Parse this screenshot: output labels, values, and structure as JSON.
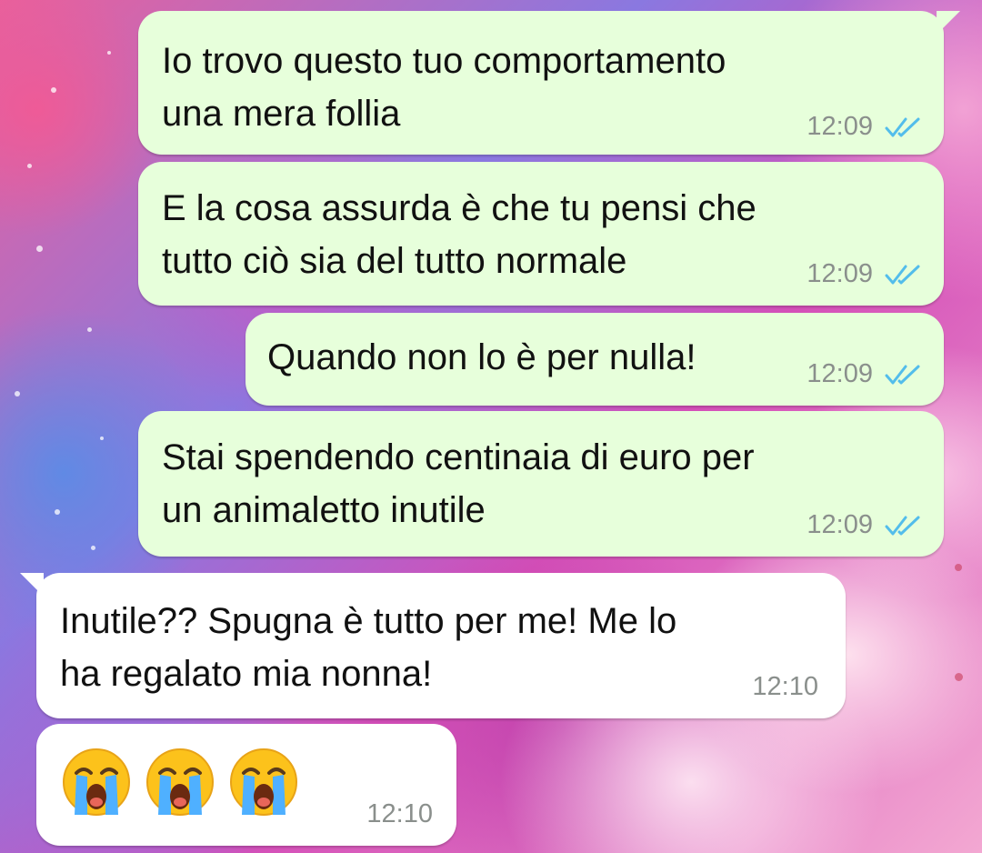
{
  "chat": {
    "messages": [
      {
        "direction": "outgoing",
        "text": "Io trovo questo tuo comportamento\nuna mera follia",
        "time": "12:09",
        "status": "read-double-check"
      },
      {
        "direction": "outgoing",
        "text": "E la cosa assurda è che tu pensi che\ntutto ciò sia del tutto normale",
        "time": "12:09",
        "status": "read-double-check"
      },
      {
        "direction": "outgoing",
        "text": "Quando non lo è per nulla!",
        "time": "12:09",
        "status": "read-double-check"
      },
      {
        "direction": "outgoing",
        "text": "Stai spendendo centinaia di euro per\nun animaletto inutile",
        "time": "12:09",
        "status": "read-double-check"
      },
      {
        "direction": "incoming",
        "text": "Inutile?? Spugna è tutto per me! Me lo\nha regalato mia nonna!",
        "time": "12:10"
      },
      {
        "direction": "incoming",
        "emojis": [
          "😭",
          "😭",
          "😭"
        ],
        "time": "12:10"
      }
    ]
  },
  "colors": {
    "outgoing_bubble": "#e7ffdb",
    "incoming_bubble": "#ffffff",
    "read_ticks": "#53bdeb",
    "timestamp": "#8a8f8c"
  },
  "icons": {
    "read_receipt": "double-check-icon",
    "emoji": "loudly-crying-face-emoji"
  }
}
